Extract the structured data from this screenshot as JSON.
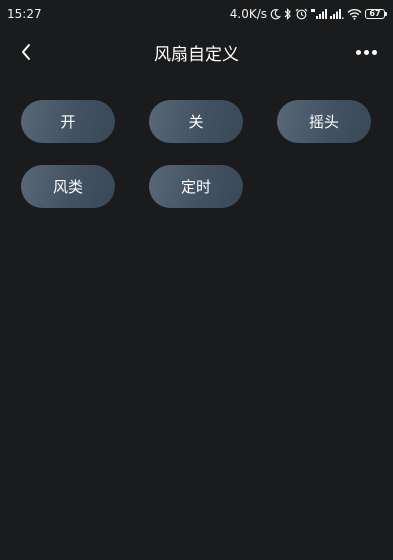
{
  "status_bar": {
    "time": "15:27",
    "net_speed": "4.0K/s",
    "battery_level": "67"
  },
  "header": {
    "title": "风扇自定义"
  },
  "buttons": [
    {
      "label": "开"
    },
    {
      "label": "关"
    },
    {
      "label": "摇头"
    },
    {
      "label": "风类"
    },
    {
      "label": "定时"
    }
  ],
  "colors": {
    "background": "#1a1b1c",
    "button_gradient_start": "#586878",
    "button_gradient_end": "#3a4857"
  }
}
